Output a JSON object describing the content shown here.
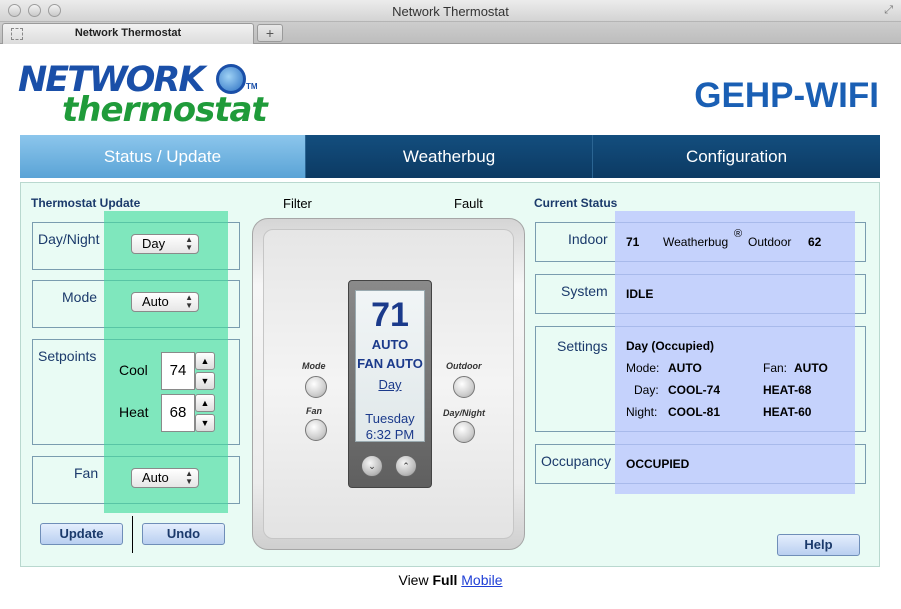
{
  "window": {
    "title": "Network Thermostat",
    "tab_label": "Network Thermostat",
    "new_tab": "+"
  },
  "header": {
    "logo_line1": "NETWORK",
    "logo_line2": "thermostat",
    "logo_tm": "TM",
    "model": "GEHP-WIFI"
  },
  "nav": {
    "tabs": [
      {
        "label": "Status / Update",
        "active": true
      },
      {
        "label": "Weatherbug",
        "active": false
      },
      {
        "label": "Configuration",
        "active": false
      }
    ]
  },
  "update": {
    "title": "Thermostat Update",
    "day_night_label": "Day/Night",
    "day_night_value": "Day",
    "mode_label": "Mode",
    "mode_value": "Auto",
    "setpoints_label": "Setpoints",
    "cool_label": "Cool",
    "cool_value": "74",
    "heat_label": "Heat",
    "heat_value": "68",
    "fan_label": "Fan",
    "fan_value": "Auto",
    "update_button": "Update",
    "undo_button": "Undo"
  },
  "device": {
    "filter_label": "Filter",
    "fault_label": "Fault",
    "temp": "71",
    "mode": "AUTO",
    "fan": "FAN AUTO",
    "period": "Day",
    "day": "Tuesday",
    "time": "6:32 PM",
    "mode_btn": "Mode",
    "fan_btn": "Fan",
    "outdoor_btn": "Outdoor",
    "daynight_btn": "Day/Night"
  },
  "status": {
    "title": "Current Status",
    "indoor_label": "Indoor",
    "indoor_value": "71",
    "weatherbug_label": "Weatherbug",
    "registered": "®",
    "outdoor_label": "Outdoor",
    "outdoor_value": "62",
    "system_label": "System",
    "system_value": "IDLE",
    "settings_label": "Settings",
    "settings_period": "Day (Occupied)",
    "mode_label": "Mode:",
    "mode_value": "AUTO",
    "fan_label": "Fan:",
    "fan_value": "AUTO",
    "day_label": "Day:",
    "day_cool": "COOL-74",
    "day_heat": "HEAT-68",
    "night_label": "Night:",
    "night_cool": "COOL-81",
    "night_heat": "HEAT-60",
    "occupancy_label": "Occupancy",
    "occupancy_value": "OCCUPIED",
    "help_button": "Help"
  },
  "footer": {
    "prefix": "View",
    "full": "Full",
    "mobile": "Mobile"
  }
}
